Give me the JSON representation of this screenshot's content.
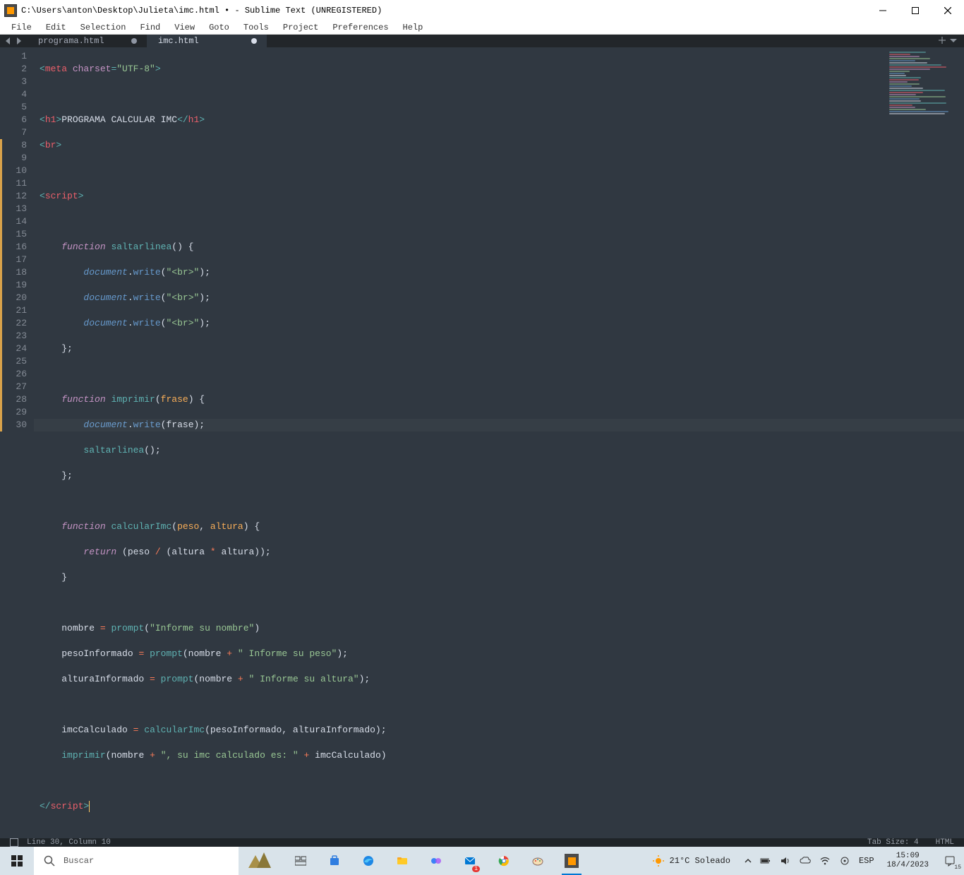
{
  "titlebar": {
    "text": "C:\\Users\\anton\\Desktop\\Julieta\\imc.html • - Sublime Text (UNREGISTERED)"
  },
  "menu": [
    "File",
    "Edit",
    "Selection",
    "Find",
    "View",
    "Goto",
    "Tools",
    "Project",
    "Preferences",
    "Help"
  ],
  "tabs": [
    {
      "label": "programa.html",
      "active": false,
      "dirty": true
    },
    {
      "label": "imc.html",
      "active": true,
      "dirty": true
    }
  ],
  "gutter": {
    "lines": 30,
    "modified": [
      8,
      9,
      10,
      11,
      12,
      13,
      14,
      15,
      16,
      17,
      18,
      19,
      20,
      21,
      22,
      23,
      24,
      25,
      26,
      27,
      28,
      29,
      30
    ]
  },
  "code": {
    "l1": {
      "a": "<",
      "b": "meta ",
      "c": "charset",
      "d": "=",
      "e": "\"UTF-8\"",
      "f": ">"
    },
    "l3": {
      "a": "<",
      "b": "h1",
      "c": ">",
      "d": "PROGRAMA CALCULAR IMC",
      "e": "</",
      "f": "h1",
      "g": ">"
    },
    "l4": {
      "a": "<",
      "b": "br",
      "c": ">"
    },
    "l6": {
      "a": "<",
      "b": "script",
      "c": ">"
    },
    "l8": {
      "a": "function ",
      "b": "saltarlinea",
      "c": "() {"
    },
    "l9": {
      "a": "document",
      "b": ".",
      "c": "write",
      "d": "(",
      "e": "\"<br>\"",
      "f": ");"
    },
    "l12": {
      "a": "};"
    },
    "l14": {
      "a": "function ",
      "b": "imprimir",
      "c": "(",
      "d": "frase",
      "e": ") {"
    },
    "l15": {
      "a": "document",
      "b": ".",
      "c": "write",
      "d": "(",
      "e": "frase",
      "f": ");"
    },
    "l16": {
      "a": "saltarlinea",
      "b": "();"
    },
    "l19": {
      "a": "function ",
      "b": "calcularImc",
      "c": "(",
      "d": "peso",
      "e": ", ",
      "f": "altura",
      "g": ") {"
    },
    "l20": {
      "a": "return ",
      "b": "(peso ",
      "c": "/",
      "d": " (altura ",
      "e": "*",
      "f": " altura));"
    },
    "l21": {
      "a": "}"
    },
    "l23": {
      "a": "nombre ",
      "b": "=",
      "c": " ",
      "d": "prompt",
      "e": "(",
      "f": "\"Informe su nombre\"",
      "g": ")"
    },
    "l24": {
      "a": "pesoInformado ",
      "b": "=",
      "c": " ",
      "d": "prompt",
      "e": "(nombre ",
      "f": "+",
      "g": " ",
      "h": "\" Informe su peso\"",
      "i": ");"
    },
    "l25": {
      "a": "alturaInformado ",
      "b": "=",
      "c": " ",
      "d": "prompt",
      "e": "(nombre ",
      "f": "+",
      "g": " ",
      "h": "\" Informe su altura\"",
      "i": ");"
    },
    "l27": {
      "a": "imcCalculado ",
      "b": "=",
      "c": " ",
      "d": "calcularImc",
      "e": "(pesoInformado, alturaInformado);"
    },
    "l28": {
      "a": "imprimir",
      "b": "(nombre ",
      "c": "+",
      "d": " ",
      "e": "\", su imc calculado es: \"",
      "f": " ",
      "g": "+",
      "h": " imcCalculado)"
    },
    "l30": {
      "a": "</",
      "b": "script",
      "c": ">"
    }
  },
  "status": {
    "pos": "Line 30, Column 10",
    "tabsize": "Tab Size: 4",
    "syntax": "HTML"
  },
  "taskbar": {
    "search_placeholder": "Buscar",
    "weather": "21°C  Soleado",
    "lang": "ESP",
    "time": "15:09",
    "date": "18/4/2023",
    "notif_count": "15"
  }
}
